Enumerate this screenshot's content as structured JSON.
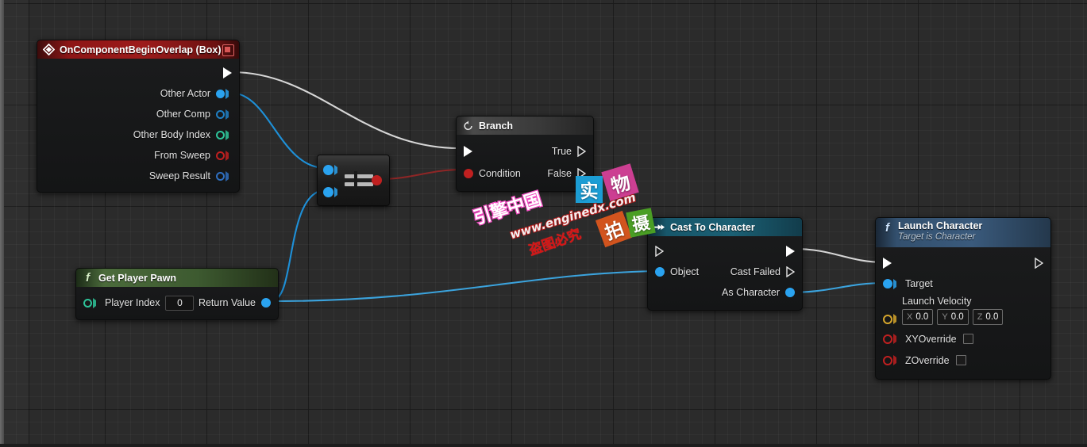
{
  "canvas": {
    "type": "blueprint-graph",
    "background_color": "#2b2b2b",
    "grid_minor_color": "rgba(255,255,255,0.035)",
    "grid_major_color": "rgba(0,0,0,0.55)"
  },
  "nodes": {
    "event": {
      "title": "OnComponentBeginOverlap (Box)",
      "title_color": "#9d1b1b",
      "icon": "event-diamond-icon",
      "close_icon": "node-close-icon",
      "outputs": [
        {
          "label": "",
          "pin": "exec",
          "connected": true
        },
        {
          "label": "Other Actor",
          "pin": "object",
          "color": "#2aa3f0",
          "connected": true
        },
        {
          "label": "Other Comp",
          "pin": "object-ref",
          "color": "#1f7fc4",
          "connected": false
        },
        {
          "label": "Other Body Index",
          "pin": "int",
          "color": "#2ec49a",
          "connected": false
        },
        {
          "label": "From Sweep",
          "pin": "bool",
          "color": "#c02020",
          "connected": false
        },
        {
          "label": "Sweep Result",
          "pin": "struct",
          "color": "#2f6fc0",
          "connected": false
        }
      ]
    },
    "equal": {
      "title": "",
      "collapsed": true,
      "operator_symbol": "=",
      "inputs": [
        {
          "pin": "object",
          "color": "#2aa3f0",
          "connected": true
        },
        {
          "pin": "object",
          "color": "#2aa3f0",
          "connected": true
        }
      ],
      "outputs": [
        {
          "pin": "bool",
          "color": "#c02020",
          "connected": true
        }
      ]
    },
    "branch": {
      "title": "Branch",
      "title_color": "#3a3a3a",
      "icon": "branch-flow-icon",
      "inputs": [
        {
          "label": "",
          "pin": "exec",
          "connected": true
        },
        {
          "label": "Condition",
          "pin": "bool",
          "color": "#c02020",
          "connected": true
        }
      ],
      "outputs": [
        {
          "label": "True",
          "pin": "exec",
          "connected": true
        },
        {
          "label": "False",
          "pin": "exec",
          "connected": false
        }
      ]
    },
    "get_player_pawn": {
      "title": "Get Player Pawn",
      "title_color": "#3d5a30",
      "icon": "function-f-icon",
      "inputs": [
        {
          "label": "Player Index",
          "pin": "int",
          "color": "#2ec49a",
          "value": "0",
          "connected": false
        }
      ],
      "outputs": [
        {
          "label": "Return Value",
          "pin": "object",
          "color": "#2aa3f0",
          "connected": true
        }
      ]
    },
    "cast_to_character": {
      "title": "Cast To Character",
      "title_color": "#1b6074",
      "icon": "cast-arrow-icon",
      "inputs": [
        {
          "label": "",
          "pin": "exec",
          "connected": false
        },
        {
          "label": "Object",
          "pin": "object",
          "color": "#2aa3f0",
          "connected": true
        }
      ],
      "outputs": [
        {
          "label": "",
          "pin": "exec",
          "connected": true
        },
        {
          "label": "Cast Failed",
          "pin": "exec",
          "connected": false
        },
        {
          "label": "As Character",
          "pin": "object",
          "color": "#2aa3f0",
          "connected": true
        }
      ]
    },
    "launch_character": {
      "title": "Launch Character",
      "subtitle": "Target is Character",
      "title_color": "#3a5a7c",
      "icon": "function-f-icon",
      "inputs": [
        {
          "label": "",
          "pin": "exec",
          "connected": true
        },
        {
          "label": "Target",
          "pin": "object",
          "color": "#2aa3f0",
          "connected": true
        },
        {
          "label": "Launch Velocity",
          "pin": "vector",
          "color": "#d6a62c",
          "connected": false
        },
        {
          "label": "XYOverride",
          "pin": "bool",
          "color": "#c02020",
          "connected": false,
          "checked": false
        },
        {
          "label": "ZOverride",
          "pin": "bool",
          "color": "#c02020",
          "connected": false,
          "checked": false
        }
      ],
      "launch_velocity": {
        "x_axis": "X",
        "x": "0.0",
        "y_axis": "Y",
        "y": "0.0",
        "z_axis": "Z",
        "z": "0.0"
      },
      "outputs": [
        {
          "label": "",
          "pin": "exec",
          "connected": false
        }
      ]
    }
  },
  "wires": [
    {
      "from": "event.exec",
      "to": "branch.exec",
      "color": "#d6d6d6",
      "type": "exec"
    },
    {
      "from": "event.other_actor",
      "to": "equal.input_a",
      "color": "#1e90d8",
      "type": "data"
    },
    {
      "from": "get_player_pawn.return_value",
      "to": "equal.input_b",
      "color": "#1e90d8",
      "type": "data"
    },
    {
      "from": "equal.output",
      "to": "branch.condition",
      "color": "#9d2b2b",
      "type": "data"
    },
    {
      "from": "get_player_pawn.return_value",
      "to": "cast.object",
      "color": "#3ba3dd",
      "type": "data"
    },
    {
      "from": "cast.exec_out",
      "to": "launch.exec_in",
      "color": "#d6d6d6",
      "type": "exec"
    },
    {
      "from": "cast.as_character",
      "to": "launch.target",
      "color": "#3ba3dd",
      "type": "data"
    }
  ],
  "watermark": {
    "brand": "引擎中国",
    "brand_color": "#ef4bc0",
    "url": "www.enginedx.com",
    "url_color": "#b01818",
    "warning": "盗图必究",
    "warning_color": "#d41616",
    "tiles": [
      {
        "char": "实",
        "bg": "#1c9dd4"
      },
      {
        "char": "物",
        "bg": "#cc3f92"
      },
      {
        "char": "拍",
        "bg": "#d2541e"
      },
      {
        "char": "摄",
        "bg": "#4a9e24"
      }
    ]
  }
}
